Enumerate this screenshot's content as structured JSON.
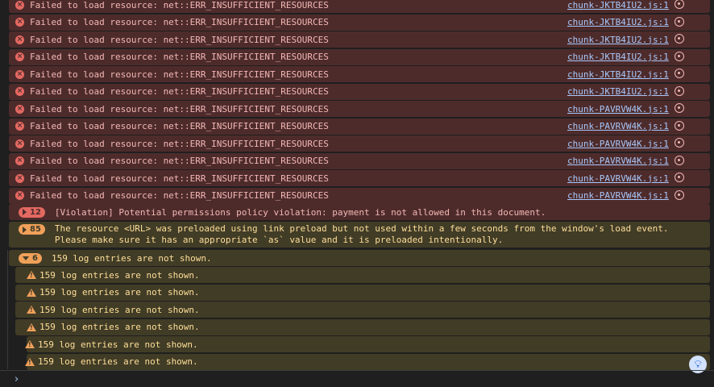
{
  "errors": [
    {
      "message": "Failed to load resource: net::ERR_INSUFFICIENT_RESOURCES",
      "source": "chunk-JKTB4IU2.js:1"
    },
    {
      "message": "Failed to load resource: net::ERR_INSUFFICIENT_RESOURCES",
      "source": "chunk-JKTB4IU2.js:1"
    },
    {
      "message": "Failed to load resource: net::ERR_INSUFFICIENT_RESOURCES",
      "source": "chunk-JKTB4IU2.js:1"
    },
    {
      "message": "Failed to load resource: net::ERR_INSUFFICIENT_RESOURCES",
      "source": "chunk-JKTB4IU2.js:1"
    },
    {
      "message": "Failed to load resource: net::ERR_INSUFFICIENT_RESOURCES",
      "source": "chunk-JKTB4IU2.js:1"
    },
    {
      "message": "Failed to load resource: net::ERR_INSUFFICIENT_RESOURCES",
      "source": "chunk-JKTB4IU2.js:1"
    },
    {
      "message": "Failed to load resource: net::ERR_INSUFFICIENT_RESOURCES",
      "source": "chunk-PAVRVW4K.js:1"
    },
    {
      "message": "Failed to load resource: net::ERR_INSUFFICIENT_RESOURCES",
      "source": "chunk-PAVRVW4K.js:1"
    },
    {
      "message": "Failed to load resource: net::ERR_INSUFFICIENT_RESOURCES",
      "source": "chunk-PAVRVW4K.js:1"
    },
    {
      "message": "Failed to load resource: net::ERR_INSUFFICIENT_RESOURCES",
      "source": "chunk-PAVRVW4K.js:1"
    },
    {
      "message": "Failed to load resource: net::ERR_INSUFFICIENT_RESOURCES",
      "source": "chunk-PAVRVW4K.js:1"
    },
    {
      "message": "Failed to load resource: net::ERR_INSUFFICIENT_RESOURCES",
      "source": "chunk-PAVRVW4K.js:1"
    }
  ],
  "violation": {
    "count": "12",
    "message": "[Violation] Potential permissions policy violation: payment is not allowed in this document."
  },
  "preload": {
    "count": "85",
    "line1": "The resource <URL> was preloaded using link preload but not used within a few seconds from the window's load event.",
    "line2": "Please make sure it has an appropriate `as` value and it is preloaded intentionally."
  },
  "group": {
    "count": "6",
    "message": "159 log entries are not shown."
  },
  "warnings": [
    {
      "message": "159 log entries are not shown.",
      "level": 1
    },
    {
      "message": "159 log entries are not shown.",
      "level": 1
    },
    {
      "message": "159 log entries are not shown.",
      "level": 1
    },
    {
      "message": "159 log entries are not shown.",
      "level": 1
    },
    {
      "message": "159 log entries are not shown.",
      "level": 2
    },
    {
      "message": "159 log entries are not shown.",
      "level": 2
    }
  ],
  "prompt": {
    "chevron": "›"
  },
  "icons": {
    "error": "error-x-icon",
    "warning": "warning-triangle-icon",
    "network": "network-request-icon",
    "insights": "lightbulb-icon"
  },
  "colors": {
    "background": "#1f1f1f",
    "error_bg": "#4e2b2b",
    "error_text": "#f2b8b5",
    "warning_bg": "#413c26",
    "warning_text": "#ffdf99",
    "link": "#a8c7fa"
  }
}
